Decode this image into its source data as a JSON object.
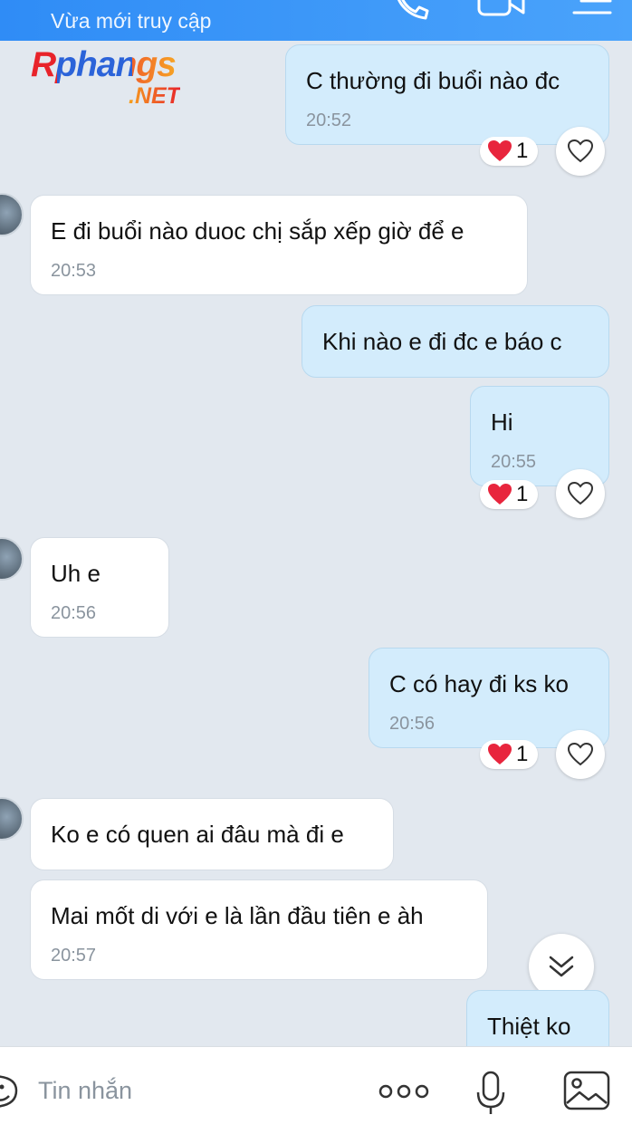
{
  "header": {
    "status": "Vừa mới truy cập",
    "icons": [
      "phone-icon",
      "video-call-icon",
      "menu-icon"
    ]
  },
  "watermark": {
    "line1": "Rphangs",
    "line2": ".NET"
  },
  "messages": [
    {
      "direction": "out",
      "text": "C thường đi buổi nào đc",
      "time": "20:52",
      "reaction": "1"
    },
    {
      "direction": "in",
      "text": "E đi buổi nào duoc chị sắp xếp giờ để e",
      "time": "20:53"
    },
    {
      "direction": "out",
      "text": "Khi nào e đi đc e báo c"
    },
    {
      "direction": "out",
      "text": "Hi",
      "time": "20:55",
      "reaction": "1"
    },
    {
      "direction": "in",
      "text": "Uh e",
      "time": "20:56"
    },
    {
      "direction": "out",
      "text": "C có hay đi ks ko",
      "time": "20:56",
      "reaction": "1"
    },
    {
      "direction": "in",
      "text": "Ko e có quen ai đâu mà đi e"
    },
    {
      "direction": "in",
      "text": "Mai mốt di với e là lần đầu tiên e àh",
      "time": "20:57"
    },
    {
      "direction": "out",
      "text": "Thiệt ko"
    }
  ],
  "composer": {
    "placeholder": "Tin nhắn",
    "icons": [
      "sticker-icon",
      "more-icon",
      "microphone-icon",
      "image-icon"
    ]
  },
  "colors": {
    "header": "#3b97f8",
    "background": "#e2e8ef",
    "outgoing_bubble": "#d3ecfc",
    "incoming_bubble": "#ffffff",
    "heart": "#e8253d"
  }
}
